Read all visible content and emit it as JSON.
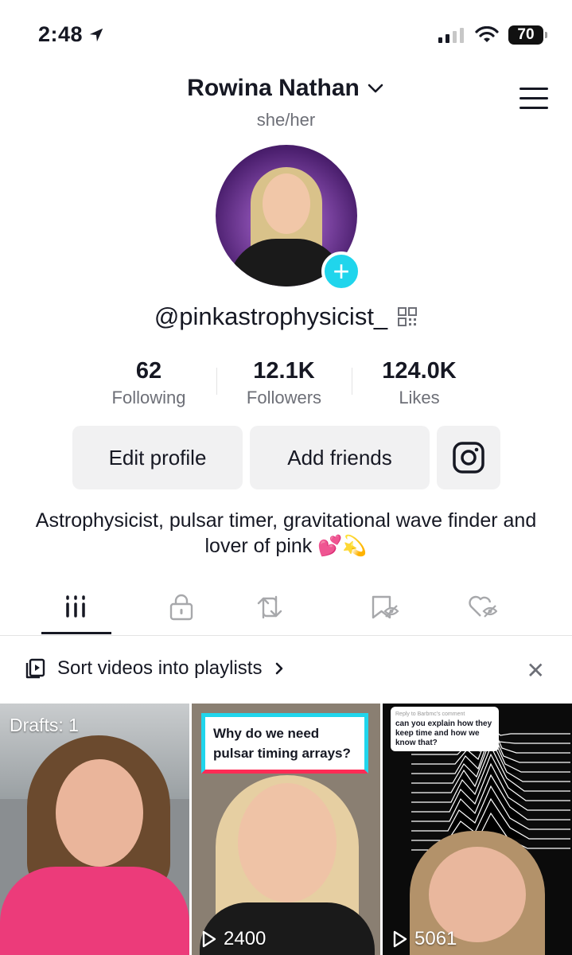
{
  "status_bar": {
    "time": "2:48",
    "battery": "70"
  },
  "profile": {
    "name": "Rowina Nathan",
    "pronouns": "she/her",
    "handle": "@pinkastrophysicist_",
    "bio": "Astrophysicist, pulsar timer, gravitational wave finder and lover of pink 💕💫"
  },
  "stats": [
    {
      "value": "62",
      "label": "Following"
    },
    {
      "value": "12.1K",
      "label": "Followers"
    },
    {
      "value": "124.0K",
      "label": "Likes"
    }
  ],
  "buttons": {
    "edit_profile": "Edit profile",
    "add_friends": "Add friends"
  },
  "sort_banner": {
    "text": "Sort videos into playlists"
  },
  "videos": [
    {
      "overlay": "Drafts: 1"
    },
    {
      "caption": "Why do we need pulsar timing arrays?",
      "views": "2400"
    },
    {
      "reply_header": "Reply to Barbmc's comment",
      "reply_text": "can you explain how they keep time and how we know that?",
      "views": "5061"
    }
  ],
  "colors": {
    "accent_cyan": "#20d5ec",
    "accent_red": "#fe2c55",
    "text": "#161823",
    "muted": "#6d6f77"
  },
  "icons": [
    "location-arrow-icon",
    "cellular-signal-icon",
    "wifi-icon",
    "battery-icon",
    "chevron-down-icon",
    "menu-icon",
    "plus-icon",
    "qr-code-icon",
    "instagram-icon",
    "grid-icon",
    "lock-icon",
    "repost-icon",
    "favorites-icon",
    "liked-hidden-icon",
    "playlist-icon",
    "chevron-right-icon",
    "close-icon",
    "play-icon"
  ]
}
